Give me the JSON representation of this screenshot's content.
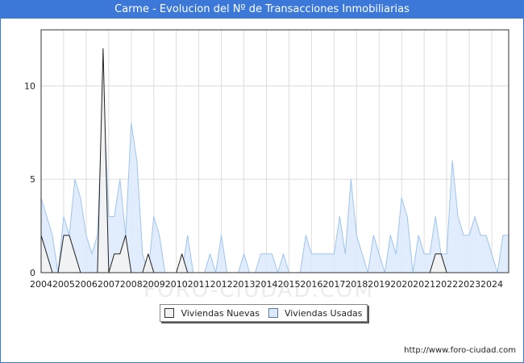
{
  "title": "Carme - Evolucion del Nº de Transacciones Inmobiliarias",
  "footer": {
    "url": "http://www.foro-ciudad.com"
  },
  "watermark": "FORO-CIUDAD.COM",
  "colors": {
    "nuevas_fill": "#f2f2f2",
    "nuevas_line": "#222222",
    "usadas_fill": "#dceafb",
    "usadas_line": "#9ec5ee",
    "grid": "#dddddd",
    "title_bg": "#3c78d8"
  },
  "chart_data": {
    "type": "area",
    "title": "Carme - Evolucion del Nº de Transacciones Inmobiliarias",
    "xlabel": "",
    "ylabel": "",
    "xlim": [
      2004,
      2024.75
    ],
    "ylim": [
      0,
      13
    ],
    "yticks": [
      0,
      5,
      10
    ],
    "xticks": [
      "2004",
      "2005",
      "2006",
      "2007",
      "2008",
      "2009",
      "2010",
      "2011",
      "2012",
      "2013",
      "2014",
      "2015",
      "2016",
      "2017",
      "2018",
      "2019",
      "2020",
      "2021",
      "2022",
      "2023",
      "2024"
    ],
    "grid": true,
    "legend_position": "bottom-center",
    "series": [
      {
        "name": "Viviendas Nuevas",
        "points": [
          [
            2004.0,
            2
          ],
          [
            2004.25,
            1
          ],
          [
            2004.5,
            0
          ],
          [
            2004.75,
            0
          ],
          [
            2005.0,
            2
          ],
          [
            2005.25,
            2
          ],
          [
            2005.5,
            1
          ],
          [
            2005.75,
            0
          ],
          [
            2006.0,
            0
          ],
          [
            2006.25,
            0
          ],
          [
            2006.5,
            0
          ],
          [
            2006.75,
            12
          ],
          [
            2007.0,
            0
          ],
          [
            2007.25,
            1
          ],
          [
            2007.5,
            1
          ],
          [
            2007.75,
            2
          ],
          [
            2008.0,
            0
          ],
          [
            2008.25,
            0
          ],
          [
            2008.5,
            0
          ],
          [
            2008.75,
            1
          ],
          [
            2009.0,
            0
          ],
          [
            2009.25,
            0
          ],
          [
            2009.5,
            0
          ],
          [
            2009.75,
            0
          ],
          [
            2010.0,
            0
          ],
          [
            2010.25,
            1
          ],
          [
            2010.5,
            0
          ],
          [
            2010.75,
            0
          ],
          [
            2011.0,
            0
          ],
          [
            2011.25,
            0
          ],
          [
            2011.5,
            0
          ],
          [
            2011.75,
            0
          ],
          [
            2012.0,
            0
          ],
          [
            2012.25,
            0
          ],
          [
            2012.5,
            0
          ],
          [
            2012.75,
            0
          ],
          [
            2013.0,
            0
          ],
          [
            2013.25,
            0
          ],
          [
            2013.5,
            0
          ],
          [
            2013.75,
            0
          ],
          [
            2014.0,
            0
          ],
          [
            2014.25,
            0
          ],
          [
            2014.5,
            0
          ],
          [
            2014.75,
            0
          ],
          [
            2015.0,
            0
          ],
          [
            2015.25,
            0
          ],
          [
            2015.5,
            0
          ],
          [
            2015.75,
            0
          ],
          [
            2016.0,
            0
          ],
          [
            2016.25,
            0
          ],
          [
            2016.5,
            0
          ],
          [
            2016.75,
            0
          ],
          [
            2017.0,
            0
          ],
          [
            2017.25,
            0
          ],
          [
            2017.5,
            0
          ],
          [
            2017.75,
            0
          ],
          [
            2018.0,
            0
          ],
          [
            2018.25,
            0
          ],
          [
            2018.5,
            0
          ],
          [
            2018.75,
            0
          ],
          [
            2019.0,
            0
          ],
          [
            2019.25,
            0
          ],
          [
            2019.5,
            0
          ],
          [
            2019.75,
            0
          ],
          [
            2020.0,
            0
          ],
          [
            2020.25,
            0
          ],
          [
            2020.5,
            0
          ],
          [
            2020.75,
            0
          ],
          [
            2021.0,
            0
          ],
          [
            2021.25,
            0
          ],
          [
            2021.5,
            1
          ],
          [
            2021.75,
            1
          ],
          [
            2022.0,
            0
          ],
          [
            2022.25,
            0
          ],
          [
            2022.5,
            0
          ],
          [
            2022.75,
            0
          ],
          [
            2023.0,
            0
          ],
          [
            2023.25,
            0
          ],
          [
            2023.5,
            0
          ],
          [
            2023.75,
            0
          ],
          [
            2024.0,
            0
          ],
          [
            2024.25,
            0
          ],
          [
            2024.5,
            0
          ],
          [
            2024.75,
            0
          ]
        ]
      },
      {
        "name": "Viviendas Usadas",
        "points": [
          [
            2004.0,
            4
          ],
          [
            2004.25,
            3
          ],
          [
            2004.5,
            2
          ],
          [
            2004.75,
            0
          ],
          [
            2005.0,
            3
          ],
          [
            2005.25,
            2
          ],
          [
            2005.5,
            5
          ],
          [
            2005.75,
            4
          ],
          [
            2006.0,
            2
          ],
          [
            2006.25,
            1
          ],
          [
            2006.5,
            2
          ],
          [
            2006.75,
            10
          ],
          [
            2007.0,
            3
          ],
          [
            2007.25,
            3
          ],
          [
            2007.5,
            5
          ],
          [
            2007.75,
            2
          ],
          [
            2008.0,
            8
          ],
          [
            2008.25,
            6
          ],
          [
            2008.5,
            1
          ],
          [
            2008.75,
            0
          ],
          [
            2009.0,
            3
          ],
          [
            2009.25,
            2
          ],
          [
            2009.5,
            0
          ],
          [
            2009.75,
            0
          ],
          [
            2010.0,
            0
          ],
          [
            2010.25,
            0
          ],
          [
            2010.5,
            2
          ],
          [
            2010.75,
            0
          ],
          [
            2011.0,
            0
          ],
          [
            2011.25,
            0
          ],
          [
            2011.5,
            1
          ],
          [
            2011.75,
            0
          ],
          [
            2012.0,
            2
          ],
          [
            2012.25,
            0
          ],
          [
            2012.5,
            0
          ],
          [
            2012.75,
            0
          ],
          [
            2013.0,
            1
          ],
          [
            2013.25,
            0
          ],
          [
            2013.5,
            0
          ],
          [
            2013.75,
            1
          ],
          [
            2014.0,
            1
          ],
          [
            2014.25,
            1
          ],
          [
            2014.5,
            0
          ],
          [
            2014.75,
            1
          ],
          [
            2015.0,
            0
          ],
          [
            2015.25,
            0
          ],
          [
            2015.5,
            0
          ],
          [
            2015.75,
            2
          ],
          [
            2016.0,
            1
          ],
          [
            2016.25,
            1
          ],
          [
            2016.5,
            1
          ],
          [
            2016.75,
            1
          ],
          [
            2017.0,
            1
          ],
          [
            2017.25,
            3
          ],
          [
            2017.5,
            1
          ],
          [
            2017.75,
            5
          ],
          [
            2018.0,
            2
          ],
          [
            2018.25,
            1
          ],
          [
            2018.5,
            0
          ],
          [
            2018.75,
            2
          ],
          [
            2019.0,
            1
          ],
          [
            2019.25,
            0
          ],
          [
            2019.5,
            2
          ],
          [
            2019.75,
            1
          ],
          [
            2020.0,
            4
          ],
          [
            2020.25,
            3
          ],
          [
            2020.5,
            0
          ],
          [
            2020.75,
            2
          ],
          [
            2021.0,
            1
          ],
          [
            2021.25,
            1
          ],
          [
            2021.5,
            3
          ],
          [
            2021.75,
            1
          ],
          [
            2022.0,
            1
          ],
          [
            2022.25,
            6
          ],
          [
            2022.5,
            3
          ],
          [
            2022.75,
            2
          ],
          [
            2023.0,
            2
          ],
          [
            2023.25,
            3
          ],
          [
            2023.5,
            2
          ],
          [
            2023.75,
            2
          ],
          [
            2024.0,
            1
          ],
          [
            2024.25,
            0
          ],
          [
            2024.5,
            2
          ],
          [
            2024.75,
            2
          ]
        ]
      }
    ]
  }
}
